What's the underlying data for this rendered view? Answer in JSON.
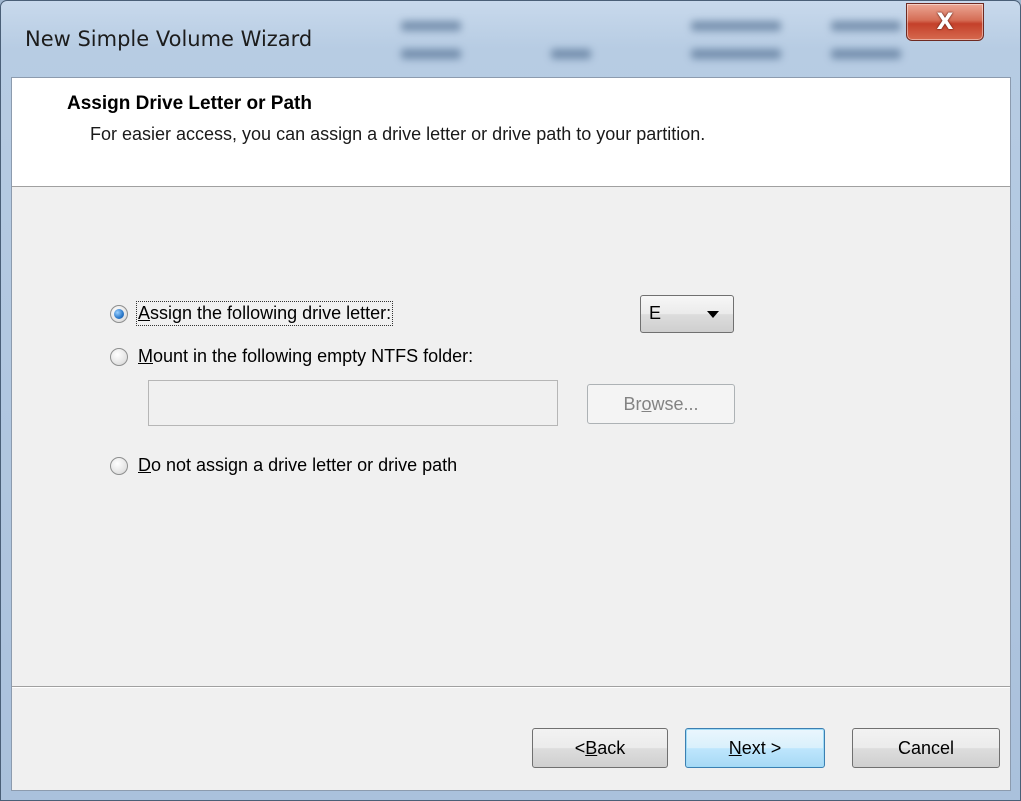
{
  "window": {
    "title": "New Simple Volume Wizard",
    "close_glyph": "X"
  },
  "header": {
    "title": "Assign Drive Letter or Path",
    "subtitle": "For easier access, you can assign a drive letter or drive path to your partition."
  },
  "options": {
    "assign_letter": {
      "access_key": "A",
      "rest": "ssign the following drive letter:",
      "checked": true
    },
    "mount_folder": {
      "access_key": "M",
      "rest": "ount in the following empty NTFS folder:",
      "checked": false
    },
    "no_assign": {
      "access_key": "D",
      "rest": "o not assign a drive letter or drive path",
      "checked": false
    }
  },
  "drive_letter": {
    "selected": "E"
  },
  "folder_path": {
    "value": ""
  },
  "browse": {
    "pre": "Br",
    "access_key": "o",
    "post": "wse...",
    "enabled": false
  },
  "footer": {
    "back_pre": "< ",
    "back_key": "B",
    "back_post": "ack",
    "next_key": "N",
    "next_post": "ext >",
    "cancel": "Cancel"
  },
  "colors": {
    "client_bg": "#f0f0f0",
    "header_bg": "#ffffff",
    "close_button": "#c4402a",
    "default_button_border": "#3c7fb1"
  }
}
